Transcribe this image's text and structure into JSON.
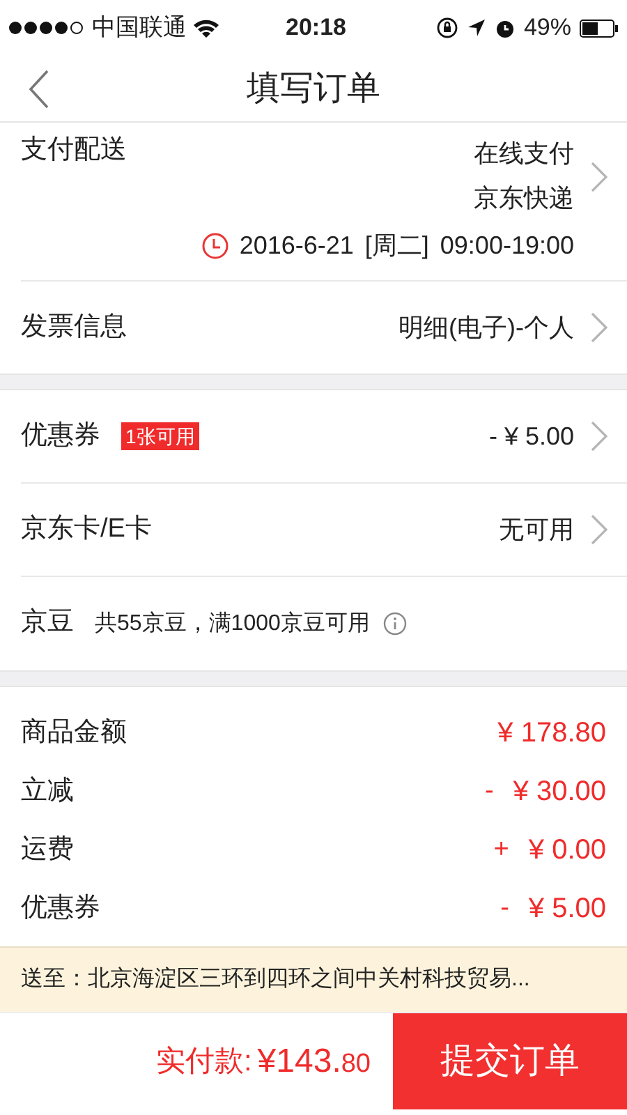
{
  "status_bar": {
    "carrier": "中国联通",
    "time": "20:18",
    "battery": "49%"
  },
  "nav": {
    "title": "填写订单"
  },
  "delivery": {
    "label": "支付配送",
    "payment": "在线支付",
    "shipping": "京东快递",
    "date": "2016-6-21",
    "weekday": "[周二]",
    "time": "09:00-19:00"
  },
  "invoice": {
    "label": "发票信息",
    "value": "明细(电子)-个人"
  },
  "discounts": [
    {
      "kind": "coupon",
      "label": "优惠券",
      "badge": "1张可用",
      "value": "- ¥ 5.00"
    },
    {
      "kind": "card",
      "label": "京东卡/E卡",
      "value": "无可用"
    },
    {
      "kind": "beans",
      "label": "京豆",
      "note": "共55京豆，满1000京豆可用"
    }
  ],
  "summary": [
    {
      "label": "商品金额",
      "amount": "¥ 178.80"
    },
    {
      "label": "立减",
      "sign": "-",
      "amount": "¥ 30.00"
    },
    {
      "label": "运费",
      "sign": "+",
      "amount": "¥ 0.00"
    },
    {
      "label": "优惠券",
      "sign": "-",
      "amount": "¥ 5.00"
    }
  ],
  "address": "送至：北京海淀区三环到四环之间中关村科技贸易...",
  "footer": {
    "total_label": "实付款:",
    "total_main": "¥143.",
    "total_cents": "80",
    "submit": "提交订单"
  }
}
